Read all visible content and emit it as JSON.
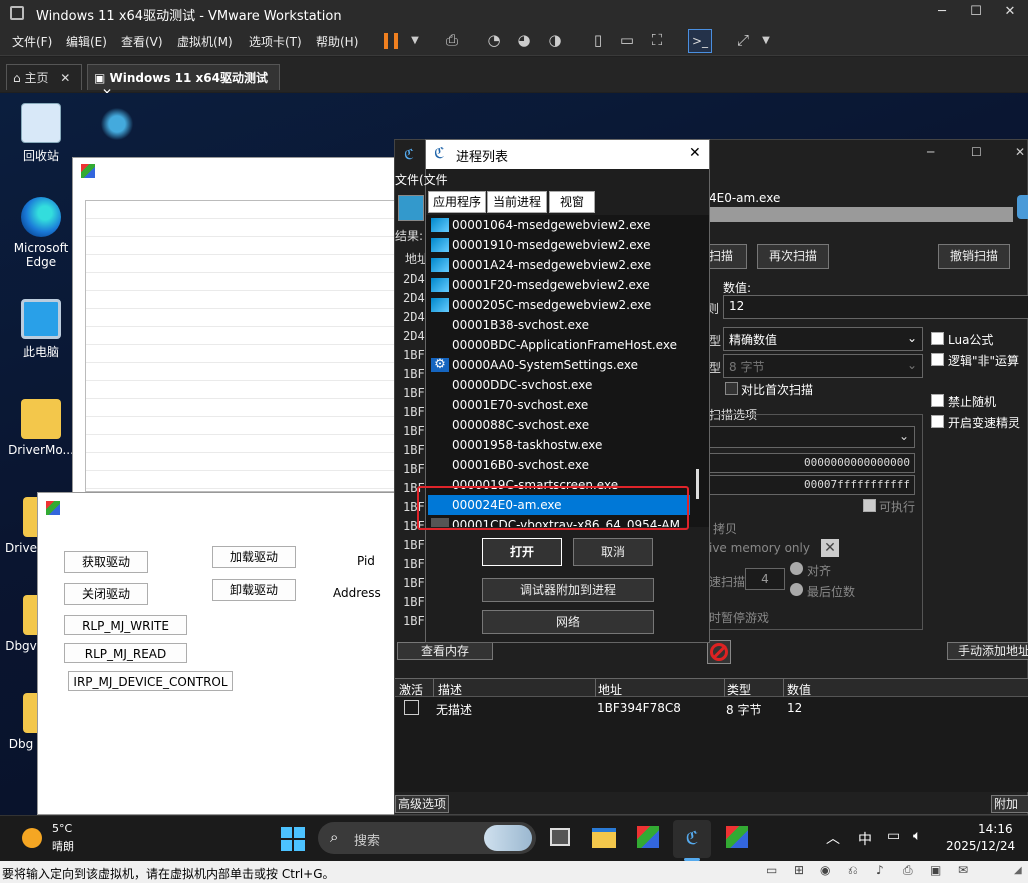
{
  "vm": {
    "title": "Windows 11 x64驱动测试 - VMware Workstation",
    "menus": [
      "文件(F)",
      "编辑(E)",
      "查看(V)",
      "虚拟机(M)",
      "选项卡(T)",
      "帮助(H)"
    ],
    "tabs": [
      "主页",
      "Windows 11 x64驱动测试"
    ],
    "status_text": "要将输入定向到该虚拟机，请在虚拟机内部单击或按 Ctrl+G。"
  },
  "desktop_icons": [
    {
      "label": "回收站"
    },
    {
      "label": "Microsoft Edge"
    },
    {
      "label": "此电脑"
    },
    {
      "label": "DriverMo..."
    },
    {
      "label": "Drive"
    },
    {
      "label": "Dbgv"
    },
    {
      "label": "Dbg"
    }
  ],
  "driver_tool": {
    "buttons": [
      "获取驱动",
      "关闭驱动",
      "RLP_MJ_WRITE",
      "RLP_MJ_READ",
      "IRP_MJ_DEVICE_CONTROL",
      "加载驱动",
      "卸载驱动"
    ],
    "pid_label": "Pid",
    "address_label": "Address"
  },
  "ce": {
    "process_name": "4E0-am.exe",
    "first_scan": "扫描",
    "next_scan": "再次扫描",
    "undo_scan": "撤销扫描",
    "value_label": "数值:",
    "value": "12",
    "scan_type_suffix": "型",
    "scan_type": "精确数值",
    "value_type_suffix": "型",
    "value_type": "8 字节",
    "compare_first": "对比首次扫描",
    "lua_formula": "Lua公式",
    "logic_not": "逻辑\"非\"运算",
    "scan_options": "扫描选项",
    "no_random": "禁止随机",
    "speedhack": "开启变速精灵",
    "start_addr": "0000000000000000",
    "stop_addr": "00007fffffffffff",
    "executable": "可执行",
    "copy_on_write": "拷贝",
    "active_memory_only": "ive memory only",
    "fast_scan": "速扫描",
    "fast_scan_value": "4",
    "align": "对齐",
    "last_digits": "最后位数",
    "pause_game": "时暂停游戏",
    "results_label": "结果:",
    "address_col_short": "地址",
    "result_addresses": [
      "2D4",
      "2D4",
      "2D4",
      "2D4",
      "1BF",
      "1BF",
      "1BF",
      "1BF",
      "1BF",
      "1BF",
      "1BF",
      "1BF",
      "1BF",
      "1BF",
      "1BF",
      "1BF",
      "1BF",
      "1BF",
      "1BF"
    ],
    "memory_view": "查看内存",
    "manual_add": "手动添加地址",
    "table_headers": [
      "激活",
      "描述",
      "地址",
      "类型",
      "数值"
    ],
    "table_rows": [
      {
        "desc": "无描述",
        "address": "1BF394F78C8",
        "type": "8 字节",
        "value": "12"
      }
    ],
    "advanced": "高级选项",
    "append": "附加注"
  },
  "proc_dialog": {
    "title": "进程列表",
    "menu": "文件(文件",
    "tabs": [
      "应用程序",
      "当前进程",
      "视窗"
    ],
    "rows": [
      "00001064-msedgewebview2.exe",
      "00001910-msedgewebview2.exe",
      "00001A24-msedgewebview2.exe",
      "00001F20-msedgewebview2.exe",
      "0000205C-msedgewebview2.exe",
      "00001B38-svchost.exe",
      "00000BDC-ApplicationFrameHost.exe",
      "00000AA0-SystemSettings.exe",
      "00000DDC-svchost.exe",
      "00001E70-svchost.exe",
      "0000088C-svchost.exe",
      "00001958-taskhostw.exe",
      "000016B0-svchost.exe",
      "0000019C-smartscreen.exe",
      "000024E0-am.exe",
      "00001CDC-vboxtray-x86_64_0954-AM"
    ],
    "selected_index": 14,
    "open": "打开",
    "cancel": "取消",
    "attach_debugger": "调试器附加到进程",
    "network": "网络"
  },
  "taskbar": {
    "weather_temp": "5°C",
    "weather_desc": "晴朗",
    "search": "搜索",
    "ime": "中",
    "time": "14:16",
    "date": "2025/12/24"
  },
  "colors": {
    "selection": "#0078d7",
    "highlight_box": "#e0242a",
    "desktop": "#0a1530"
  }
}
